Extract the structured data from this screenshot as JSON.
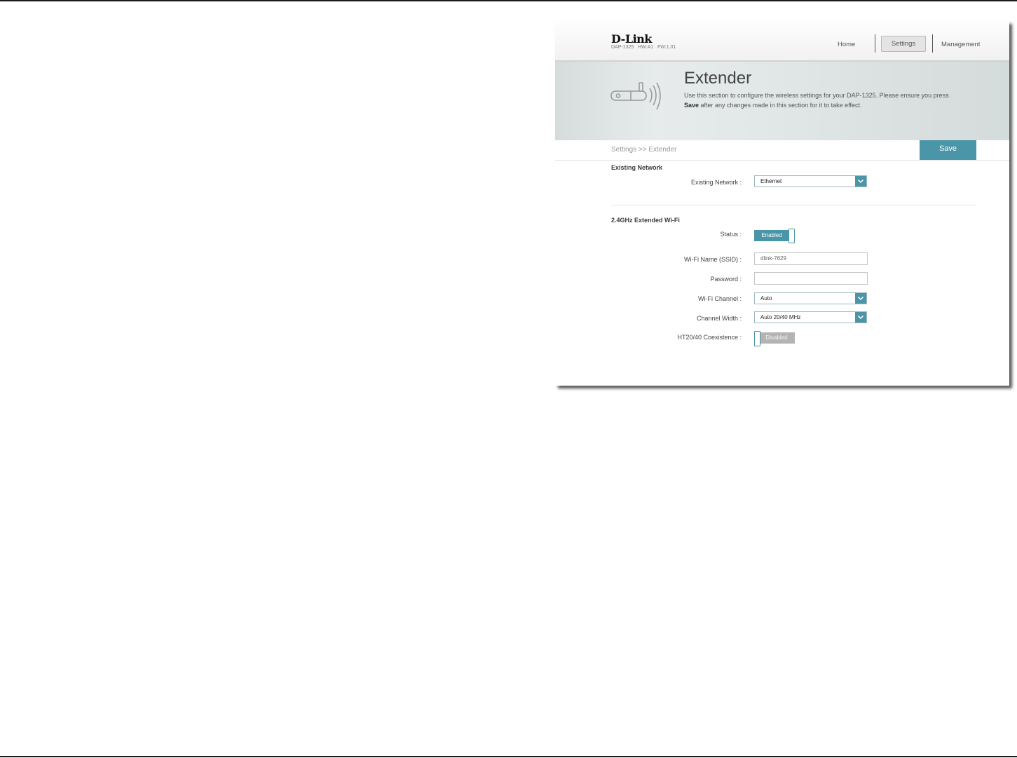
{
  "brand": {
    "logo_text": "D-Link",
    "device_info": "DAP-1325   HW:A1   FW:1.01"
  },
  "nav": {
    "home": "Home",
    "settings": "Settings",
    "management": "Management"
  },
  "hero": {
    "title": "Extender",
    "desc_part1": "Use this section to configure the wireless settings for your DAP-1325. Please ensure you press ",
    "desc_bold": "Save",
    "desc_part2": " after any changes made in this section for it to take effect."
  },
  "breadcrumb": "Settings >> Extender",
  "save_label": "Save",
  "existing_network": {
    "section_title": "Existing Network",
    "label": "Existing Network :",
    "value": "Ethernet"
  },
  "extended_wifi": {
    "section_title": "2.4GHz Extended Wi-Fi",
    "status_label": "Status :",
    "status_value": "Enabled",
    "ssid_label": "Wi-Fi Name (SSID) :",
    "ssid_value": "dlink-7629",
    "password_label": "Password :",
    "password_value": "",
    "channel_label": "Wi-Fi Channel :",
    "channel_value": "Auto",
    "width_label": "Channel Width :",
    "width_value": "Auto 20/40 MHz",
    "coexistence_label": "HT20/40 Coexistence :",
    "coexistence_value": "Disabled"
  },
  "colors": {
    "accent": "#4a95a7",
    "toggle_off": "#b4b4b4"
  }
}
